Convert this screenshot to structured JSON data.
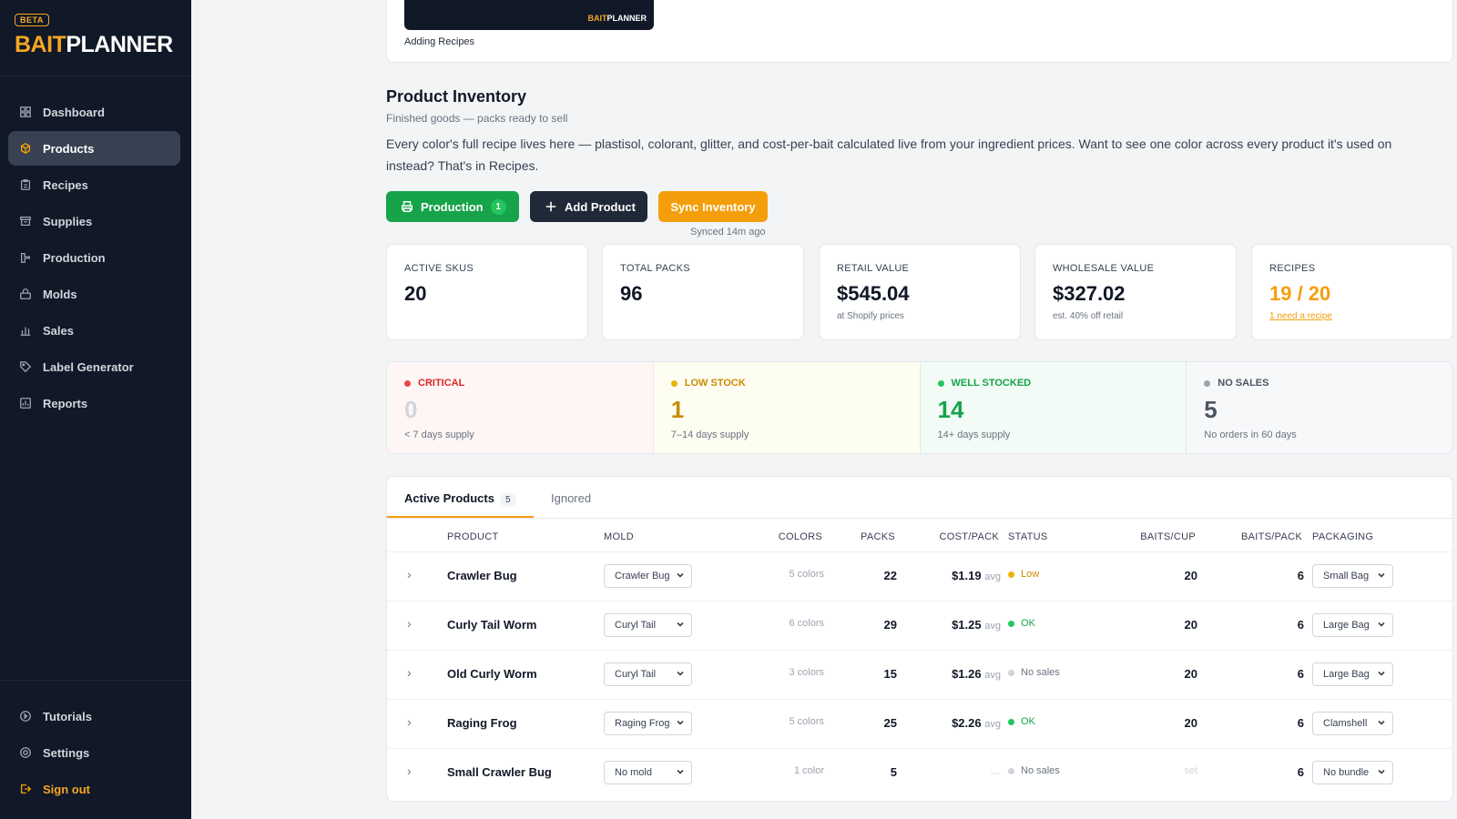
{
  "sidebar": {
    "beta": "BETA",
    "logo_a": "BAIT",
    "logo_b": "PLANNER",
    "items": [
      {
        "label": "Dashboard"
      },
      {
        "label": "Products"
      },
      {
        "label": "Recipes"
      },
      {
        "label": "Supplies"
      },
      {
        "label": "Production"
      },
      {
        "label": "Molds"
      },
      {
        "label": "Sales"
      },
      {
        "label": "Label Generator"
      },
      {
        "label": "Reports"
      }
    ],
    "bottom": [
      {
        "label": "Tutorials"
      },
      {
        "label": "Settings"
      },
      {
        "label": "Sign out"
      }
    ]
  },
  "video": {
    "caption": "Adding Recipes",
    "logo_a": "BAIT",
    "logo_b": "PLANNER"
  },
  "header": {
    "title": "Product Inventory",
    "subtitle": "Finished goods — packs ready to sell",
    "description": "Every color's full recipe lives here — plastisol, colorant, glitter, and cost-per-bait calculated live from your ingredient prices. Want to see one color across every product it's used on instead? That's in Recipes."
  },
  "actions": {
    "production_label": "Production",
    "production_count": "1",
    "add_label": "Add Product",
    "sync_label": "Sync Inventory",
    "synced_text": "Synced 14m ago"
  },
  "stats": [
    {
      "label": "ACTIVE SKUS",
      "value": "20",
      "sub": ""
    },
    {
      "label": "TOTAL PACKS",
      "value": "96",
      "sub": ""
    },
    {
      "label": "RETAIL VALUE",
      "value": "$545.04",
      "sub": "at Shopify prices"
    },
    {
      "label": "WHOLESALE VALUE",
      "value": "$327.02",
      "sub": "est. 40% off retail"
    },
    {
      "label": "RECIPES",
      "value": "19 / 20",
      "sub": "1 need a recipe"
    }
  ],
  "levels": [
    {
      "label": "CRITICAL",
      "value": "0",
      "sub": "< 7 days supply",
      "color": "#ef4444",
      "num_color": "#d1d5db"
    },
    {
      "label": "LOW STOCK",
      "value": "1",
      "sub": "7–14 days supply",
      "color": "#eab308",
      "num_color": "#ca8a04"
    },
    {
      "label": "WELL STOCKED",
      "value": "14",
      "sub": "14+ days supply",
      "color": "#22c55e",
      "num_color": "#16a34a"
    },
    {
      "label": "NO SALES",
      "value": "5",
      "sub": "No orders in 60 days",
      "color": "#9ca3af",
      "num_color": "#4b5563"
    }
  ],
  "tabs": {
    "active": "Active Products",
    "active_count": "5",
    "ignored": "Ignored"
  },
  "columns": [
    "PRODUCT",
    "MOLD",
    "COLORS",
    "PACKS",
    "COST/PACK",
    "STATUS",
    "BAITS/CUP",
    "BAITS/PACK",
    "PACKAGING"
  ],
  "rows": [
    {
      "name": "Crawler Bug",
      "mold": "Crawler Bug",
      "colors": "5 colors",
      "packs": "22",
      "cost": "$1.19",
      "avg": "avg",
      "status": "Low",
      "status_color": "#eab308",
      "baits_cup": "20",
      "baits_pack": "6",
      "packaging": "Small Bag"
    },
    {
      "name": "Curly Tail Worm",
      "mold": "Curyl Tail",
      "colors": "6 colors",
      "packs": "29",
      "cost": "$1.25",
      "avg": "avg",
      "status": "OK",
      "status_color": "#22c55e",
      "baits_cup": "20",
      "baits_pack": "6",
      "packaging": "Large Bag"
    },
    {
      "name": "Old Curly Worm",
      "mold": "Curyl Tail",
      "colors": "3 colors",
      "packs": "15",
      "cost": "$1.26",
      "avg": "avg",
      "status": "No sales",
      "status_color": "#d1d5db",
      "baits_cup": "20",
      "baits_pack": "6",
      "packaging": "Large Bag"
    },
    {
      "name": "Raging Frog",
      "mold": "Raging Frog",
      "colors": "5 colors",
      "packs": "25",
      "cost": "$2.26",
      "avg": "avg",
      "status": "OK",
      "status_color": "#22c55e",
      "baits_cup": "20",
      "baits_pack": "6",
      "packaging": "Clamshell"
    },
    {
      "name": "Small Crawler Bug",
      "mold": "No mold",
      "colors": "1 color",
      "packs": "5",
      "cost": "—",
      "avg": "",
      "status": "No sales",
      "status_color": "#d1d5db",
      "baits_cup": "set",
      "baits_pack": "6",
      "packaging": "No bundle"
    }
  ],
  "colors": {
    "accent": "#f59e0b",
    "sidebar_bg": "#111827",
    "green": "#16a34a"
  }
}
